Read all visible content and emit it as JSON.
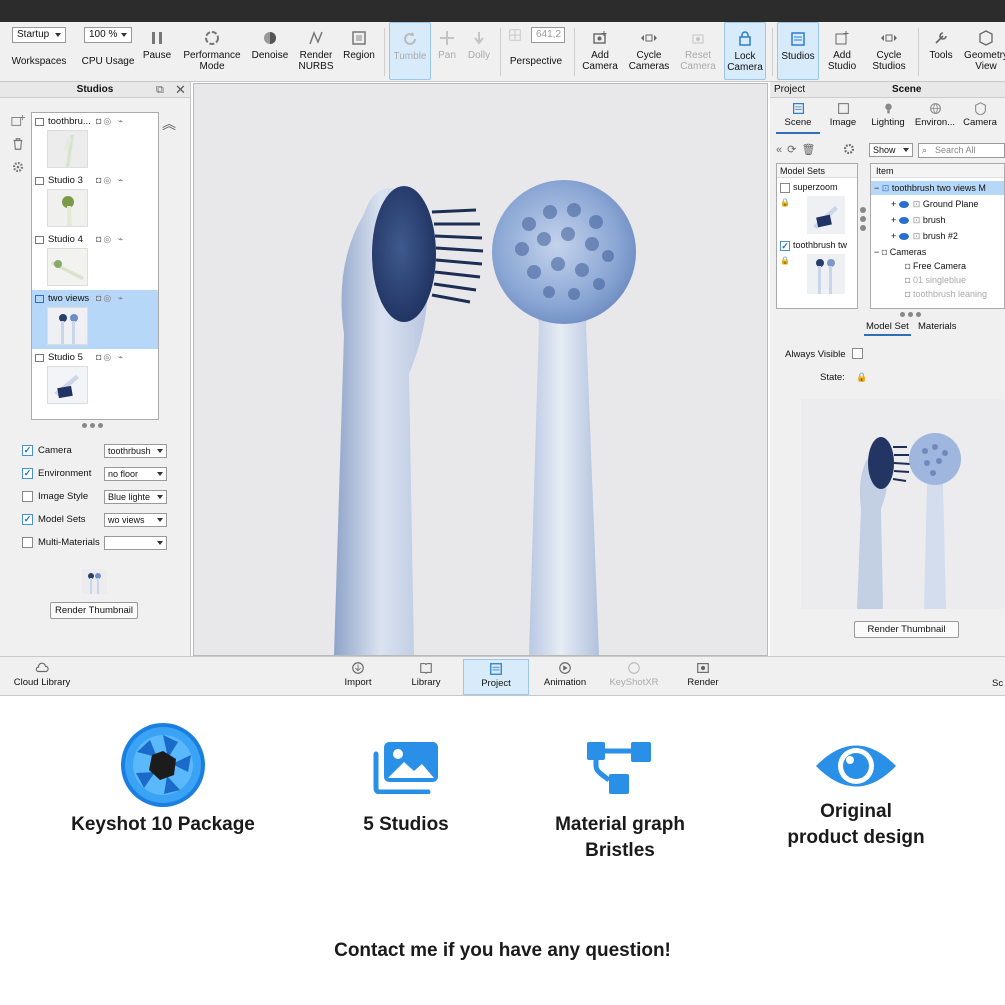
{
  "toolbar": {
    "workspace_select": "Startup",
    "workspaces_label": "Workspaces",
    "cpu_select": "100 %",
    "cpu_label": "CPU Usage",
    "pause": "Pause",
    "performance_mode": "Performance Mode",
    "denoise": "Denoise",
    "render_nurbs": "Render NURBS",
    "region": "Region",
    "tumble": "Tumble",
    "pan": "Pan",
    "dolly": "Dolly",
    "perspective_value": "641,2",
    "perspective": "Perspective",
    "add_camera": "Add Camera",
    "cycle_cameras": "Cycle Cameras",
    "reset_camera": "Reset Camera",
    "lock_camera": "Lock Camera",
    "studios": "Studios",
    "add_studio": "Add Studio",
    "cycle_studios": "Cycle Studios",
    "tools": "Tools",
    "geometry_view": "Geometry View"
  },
  "studios_panel": {
    "title": "Studios",
    "items": [
      {
        "name": "toothbru..."
      },
      {
        "name": "Studio 3"
      },
      {
        "name": "Studio 4"
      },
      {
        "name": "two views"
      },
      {
        "name": "Studio 5"
      }
    ],
    "selected_index": 3,
    "props": [
      {
        "label": "Camera",
        "checked": true,
        "value": "toothrbush"
      },
      {
        "label": "Environment",
        "checked": true,
        "value": "no floor"
      },
      {
        "label": "Image Style",
        "checked": false,
        "value": "Blue lighte"
      },
      {
        "label": "Model Sets",
        "checked": true,
        "value": "wo views"
      },
      {
        "label": "Multi-Materials",
        "checked": false,
        "value": ""
      }
    ],
    "render_thumbnail": "Render Thumbnail"
  },
  "project_panel": {
    "header_left": "Project",
    "header_center": "Scene",
    "tabs": [
      "Scene",
      "Image",
      "Lighting",
      "Environ...",
      "Camera"
    ],
    "show_select": "Show",
    "search_placeholder": "Search All",
    "model_sets_header": "Model Sets",
    "model_sets": [
      {
        "name": "superzoom",
        "checked": false
      },
      {
        "name": "toothbrush tw",
        "checked": true
      }
    ],
    "tree_header": "Item",
    "tree": [
      {
        "label": "toothbrush two views M",
        "selected": true
      },
      {
        "label": "Ground Plane"
      },
      {
        "label": "brush"
      },
      {
        "label": "brush #2"
      },
      {
        "label": "Cameras"
      },
      {
        "label": "Free Camera"
      },
      {
        "label": "01 singleblue"
      },
      {
        "label": "toothbrush leaning"
      }
    ],
    "subtabs": [
      "Model Set",
      "Materials"
    ],
    "always_visible": "Always Visible",
    "state": "State:",
    "render_thumbnail": "Render Thumbnail"
  },
  "bottom_bar": {
    "cloud_library": "Cloud Library",
    "items": [
      "Import",
      "Library",
      "Project",
      "Animation",
      "KeyShotXR",
      "Render"
    ],
    "right_clip": "Sc"
  },
  "features": [
    {
      "line1": "Keyshot 10 Package",
      "line2": "",
      "icon": "keyshot-logo-icon"
    },
    {
      "line1": "5 Studios",
      "line2": "",
      "icon": "images-icon"
    },
    {
      "line1": "Material graph",
      "line2": "Bristles",
      "icon": "node-graph-icon"
    },
    {
      "line1": "Original",
      "line2": "product design",
      "icon": "eye-icon"
    }
  ],
  "contact": "Contact me if you have any question!",
  "colors": {
    "accent": "#2a8fe6",
    "selection": "#b6d7f7"
  }
}
